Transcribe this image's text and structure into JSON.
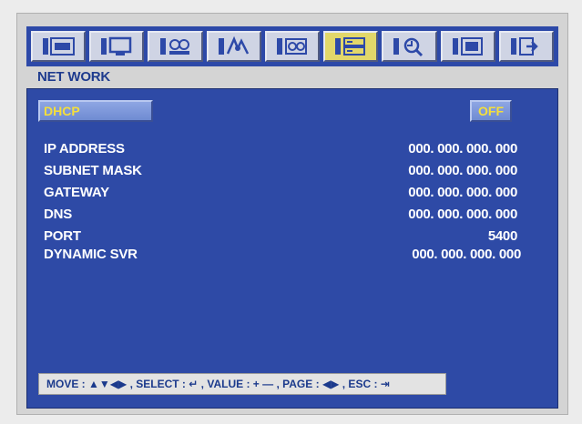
{
  "toolbar": {
    "icons": [
      {
        "name": "display-icon",
        "active": false
      },
      {
        "name": "monitor-icon",
        "active": false
      },
      {
        "name": "camera-icon",
        "active": false
      },
      {
        "name": "motion-icon",
        "active": false
      },
      {
        "name": "record-icon",
        "active": false
      },
      {
        "name": "network-icon",
        "active": true
      },
      {
        "name": "search-icon",
        "active": false
      },
      {
        "name": "system-icon",
        "active": false
      },
      {
        "name": "exit-icon",
        "active": false
      }
    ]
  },
  "section_title": "NET WORK",
  "dhcp": {
    "label": "DHCP",
    "value": "OFF"
  },
  "fields": [
    {
      "label": "IP ADDRESS",
      "value": "000. 000. 000. 000"
    },
    {
      "label": "SUBNET MASK",
      "value": "000. 000. 000. 000"
    },
    {
      "label": "GATEWAY",
      "value": "000. 000. 000. 000"
    },
    {
      "label": "DNS",
      "value": "000. 000. 000. 000"
    },
    {
      "label": "PORT",
      "value": "5400"
    },
    {
      "label": "DYNAMIC SVR",
      "value": "000. 000. 000. 000"
    }
  ],
  "help": {
    "move": "MOVE :",
    "move_keys": "▲▼◀▶",
    "select": ", SELECT :",
    "select_key": "↵",
    "value": ", VALUE :",
    "value_keys": "+ —",
    "page": ", PAGE :",
    "page_keys": "◀▶",
    "esc": ", ESC :",
    "esc_key": "⇥"
  },
  "colors": {
    "panel": "#2e4aa6",
    "highlight_text": "#f5df3a",
    "title_text": "#1e3b8e"
  }
}
